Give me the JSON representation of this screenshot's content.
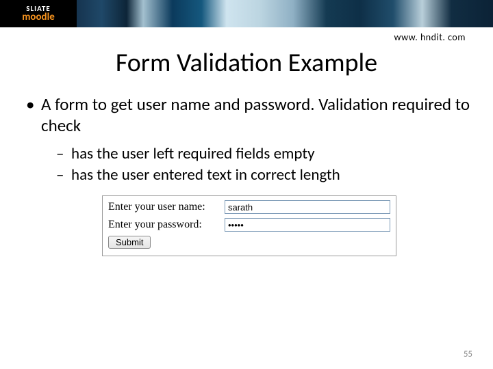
{
  "banner": {
    "logo_line1": "SLIATE",
    "logo_line2": "moodle"
  },
  "url": "www. hndit. com",
  "title": "Form Validation Example",
  "bullet": "A form to get user name and password. Validation required to check",
  "subbullets": [
    "has the user left required fields empty",
    "has the user entered text in correct length"
  ],
  "form": {
    "username_label": "Enter your user name:",
    "username_value": "sarath",
    "password_label": "Enter your password:",
    "password_value": "•••••",
    "submit_label": "Submit"
  },
  "page_number": "55"
}
